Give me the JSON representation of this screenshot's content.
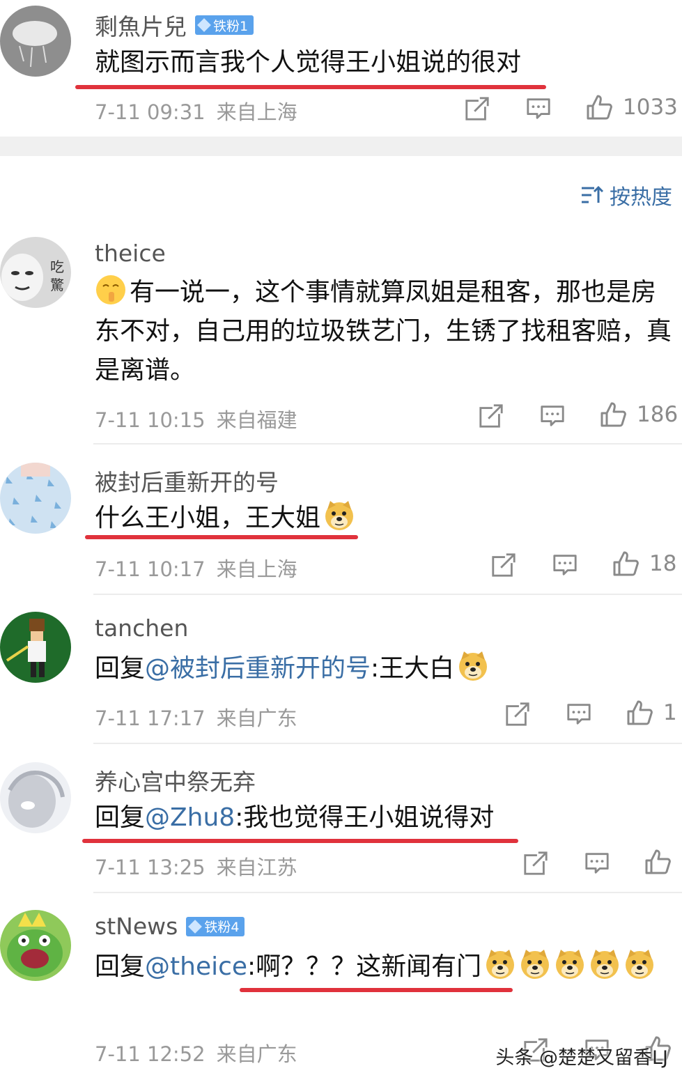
{
  "section_sort_label": "按热度",
  "sort_icon": "sort-icon",
  "comments": [
    {
      "username": "剩魚片兒",
      "badge": "铁粉1",
      "text": "就图示而言我个人觉得王小姐说的很对",
      "date": "7-11 09:31",
      "location": "来自上海",
      "likes": "1033"
    },
    {
      "username": "theice",
      "text": "有一说一，这个事情就算凤姐是租客，那也是房东不对，自己用的垃圾铁艺门，生锈了找租客赔，真是离谱。",
      "date": "7-11 10:15",
      "location": "来自福建",
      "likes": "186"
    },
    {
      "username": "被封后重新开的号",
      "text": "什么王小姐，王大姐",
      "date": "7-11 10:17",
      "location": "来自上海",
      "likes": "18"
    },
    {
      "username": "tanchen",
      "reply_prefix": "回复",
      "mention": "@被封后重新开的号",
      "text": ":王大白",
      "date": "7-11 17:17",
      "location": "来自广东",
      "likes": "1"
    },
    {
      "username": "养心宫中祭无弃",
      "reply_prefix": "回复",
      "mention": "@Zhu8",
      "text": ":我也觉得王小姐说得对",
      "date": "7-11 13:25",
      "location": "来自江苏",
      "likes": ""
    },
    {
      "username": "stNews",
      "badge": "铁粉4",
      "reply_prefix": "回复",
      "mention": "@theice",
      "text": ":啊？？？这新闻有门",
      "date": "7-11 12:52",
      "location": "来自广东",
      "likes": ""
    }
  ],
  "watermark": "头条 @楚楚又留香LJ",
  "colors": {
    "mention": "#3a6ea5",
    "underline": "#e0323c",
    "badge": "#5aa2ec",
    "meta": "#999999"
  }
}
